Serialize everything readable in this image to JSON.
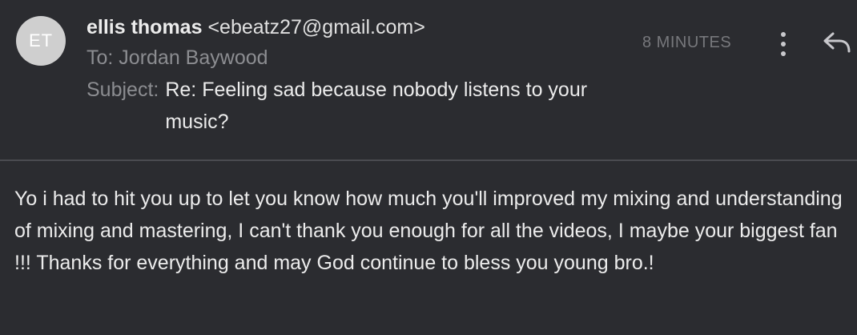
{
  "avatar": {
    "initials": "ET"
  },
  "sender": {
    "name": "ellis thomas",
    "email": "<ebeatz27@gmail.com>"
  },
  "recipient": {
    "text": "To: Jordan Baywood"
  },
  "subject": {
    "label": "Subject:",
    "value": "Re: Feeling sad because nobody listens to your music?"
  },
  "time": "8 MINUTES",
  "icons": {
    "more": "more-vertical-icon",
    "reply": "reply-icon"
  },
  "body": "Yo i had to hit you up to let you know how much you'll improved my mixing and understanding of mixing and mastering, I can't thank you enough for all the videos, I maybe your biggest fan !!! Thanks for everything and may God continue to bless you young bro.!"
}
